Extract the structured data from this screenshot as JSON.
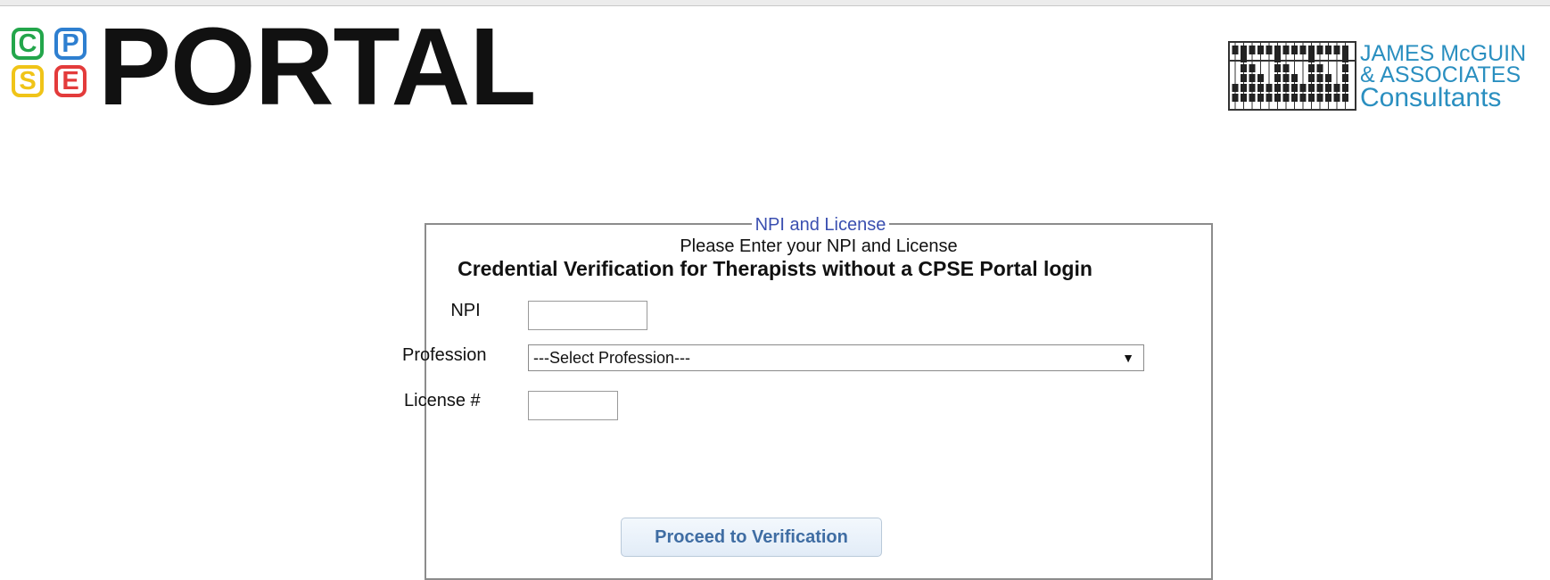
{
  "header": {
    "logo_letters": {
      "c": "C",
      "p": "P",
      "s": "S",
      "e": "E"
    },
    "portal_word": "PORTAL",
    "company": {
      "line1": "JAMES McGUIN",
      "line2": "& ASSOCIATES",
      "line3": "Consultants"
    }
  },
  "page": {
    "title": "Credential Verification for Therapists without a CPSE Portal login"
  },
  "form": {
    "legend": "NPI and License",
    "instructions": "Please Enter your NPI and License",
    "npi_label": "NPI",
    "npi_value": "",
    "profession_label": "Profession",
    "profession_selected": "---Select Profession---",
    "license_label": "License #",
    "license_value": "",
    "submit_label": "Proceed to Verification"
  },
  "colors": {
    "logo_c": "#23a64b",
    "logo_p": "#2e7fd0",
    "logo_s": "#f0c418",
    "logo_e": "#e33b3b",
    "company_text": "#2a8fc0",
    "legend_text": "#3a4fb0",
    "button_text": "#3f6da3"
  },
  "icons": {
    "select_arrow": "triangle-down-icon",
    "company_logo": "abacus-icon"
  }
}
